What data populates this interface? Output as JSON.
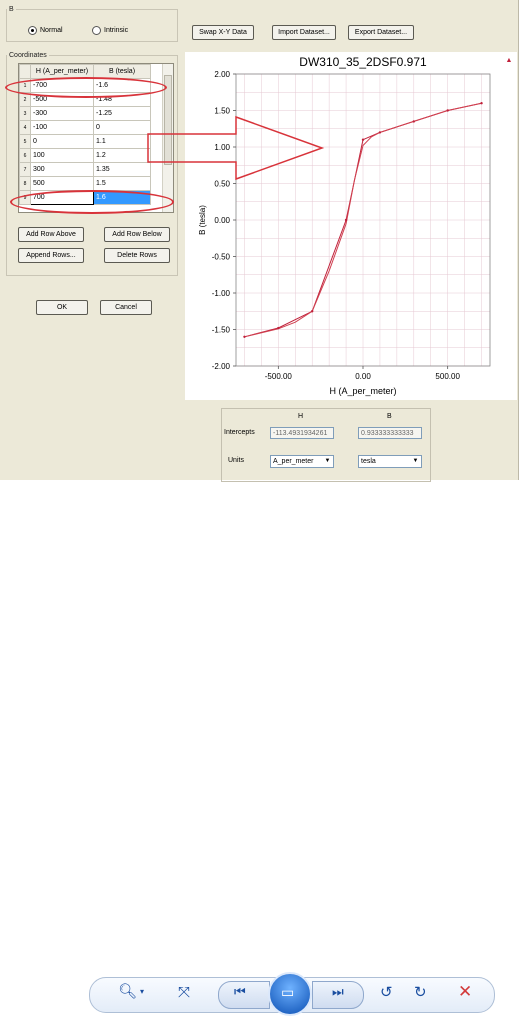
{
  "mode_group": {
    "title": "B",
    "options": [
      "Normal",
      "Intrinsic"
    ],
    "selected": "Normal"
  },
  "coordinates": {
    "title": "Coordinates",
    "columns": [
      "H (A_per_meter)",
      "B (tesla)"
    ],
    "rows": [
      {
        "n": "1",
        "h": "-700",
        "b": "-1.6"
      },
      {
        "n": "2",
        "h": "-500",
        "b": "-1.48"
      },
      {
        "n": "3",
        "h": "-300",
        "b": "-1.25"
      },
      {
        "n": "4",
        "h": "-100",
        "b": "0"
      },
      {
        "n": "5",
        "h": "0",
        "b": "1.1"
      },
      {
        "n": "6",
        "h": "100",
        "b": "1.2"
      },
      {
        "n": "7",
        "h": "300",
        "b": "1.35"
      },
      {
        "n": "8",
        "h": "500",
        "b": "1.5"
      },
      {
        "n": "9",
        "h": "700",
        "b": "1.6"
      }
    ]
  },
  "buttons": {
    "add_above": "Add Row Above",
    "add_below": "Add Row Below",
    "append": "Append Rows...",
    "delete": "Delete Rows",
    "ok": "OK",
    "cancel": "Cancel",
    "swap": "Swap X-Y Data",
    "import": "Import Dataset...",
    "export": "Export Dataset..."
  },
  "chart_data": {
    "type": "line",
    "title": "DW310_35_2DSF0.971",
    "xlabel": "H (A_per_meter)",
    "ylabel": "B (tesla)",
    "xlim": [
      -750,
      750
    ],
    "ylim": [
      -2.0,
      2.0
    ],
    "xticks": [
      "-500.00",
      "0.00",
      "500.00"
    ],
    "yticks": [
      "2.00",
      "1.50",
      "1.00",
      "0.50",
      "0.00",
      "-0.50",
      "-1.00",
      "-1.50",
      "-2.00"
    ],
    "grid": true,
    "series": [
      {
        "name": "",
        "x": [
          -700,
          -500,
          -300,
          -100,
          0,
          100,
          300,
          500,
          700
        ],
        "y": [
          -1.6,
          -1.48,
          -1.25,
          0,
          1.1,
          1.2,
          1.35,
          1.5,
          1.6
        ],
        "color": "#c0203a"
      },
      {
        "name": "",
        "x": [
          -700,
          -500,
          -400,
          -300,
          -200,
          -100,
          -50,
          0,
          50,
          100,
          300,
          500,
          700
        ],
        "y": [
          -1.6,
          -1.49,
          -1.4,
          -1.25,
          -0.7,
          -0.05,
          0.55,
          1.02,
          1.14,
          1.2,
          1.35,
          1.5,
          1.6
        ],
        "color": "#d04050"
      }
    ]
  },
  "intercepts": {
    "col_h": "H",
    "col_b": "B",
    "label": "Intercepts",
    "h_value": "-113.4931934261",
    "b_value": "0.933333333333",
    "units_label": "Units",
    "h_unit": "A_per_meter",
    "b_unit": "tesla"
  },
  "accent": "#d8333a"
}
